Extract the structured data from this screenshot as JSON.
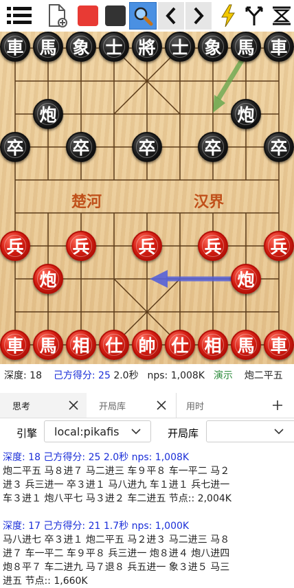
{
  "toolbar": {
    "buttons": [
      {
        "name": "menu-icon"
      },
      {
        "name": "new-game-icon"
      },
      {
        "name": "red-side-icon",
        "color": "#e83a34"
      },
      {
        "name": "black-side-icon",
        "color": "#333333"
      },
      {
        "name": "search-icon"
      },
      {
        "name": "previous-icon"
      },
      {
        "name": "next-icon"
      },
      {
        "name": "lightning-icon",
        "color": "#f2c800"
      },
      {
        "name": "branch-icon"
      },
      {
        "name": "flip-board-icon"
      }
    ]
  },
  "board": {
    "river_left": "楚河",
    "river_right": "汉界",
    "pieces": [
      {
        "c": "車",
        "side": "black"
      },
      {
        "c": "馬",
        "side": "black"
      },
      {
        "c": "象",
        "side": "black"
      },
      {
        "c": "士",
        "side": "black"
      },
      {
        "c": "將",
        "side": "black"
      },
      {
        "c": "士",
        "side": "black"
      },
      {
        "c": "象",
        "side": "black"
      },
      {
        "c": "馬",
        "side": "black"
      },
      {
        "c": "車",
        "side": "black"
      },
      {
        "c": "炮",
        "side": "black"
      },
      {
        "c": "炮",
        "side": "black"
      },
      {
        "c": "卒",
        "side": "black"
      },
      {
        "c": "卒",
        "side": "black"
      },
      {
        "c": "卒",
        "side": "black"
      },
      {
        "c": "卒",
        "side": "black"
      },
      {
        "c": "卒",
        "side": "black"
      },
      {
        "c": "兵",
        "side": "red"
      },
      {
        "c": "兵",
        "side": "red"
      },
      {
        "c": "兵",
        "side": "red"
      },
      {
        "c": "兵",
        "side": "red"
      },
      {
        "c": "兵",
        "side": "red"
      },
      {
        "c": "炮",
        "side": "red"
      },
      {
        "c": "炮",
        "side": "red"
      },
      {
        "c": "車",
        "side": "red"
      },
      {
        "c": "馬",
        "side": "red"
      },
      {
        "c": "相",
        "side": "red"
      },
      {
        "c": "仕",
        "side": "red"
      },
      {
        "c": "帥",
        "side": "red"
      },
      {
        "c": "仕",
        "side": "red"
      },
      {
        "c": "相",
        "side": "red"
      },
      {
        "c": "馬",
        "side": "red"
      },
      {
        "c": "車",
        "side": "red"
      }
    ],
    "arrow_colors": {
      "blue": "#5560d8",
      "green": "#6aa84f"
    }
  },
  "status": {
    "depth": "深度: 18",
    "score": "己方得分: 25",
    "time": "2.0秒",
    "nps": "nps: 1,008K",
    "demo": "演示",
    "move": "炮二平五"
  },
  "tabs": [
    {
      "label": "思考",
      "active": true
    },
    {
      "label": "开局库",
      "active": false
    },
    {
      "label": "用时",
      "active": false
    }
  ],
  "engine": {
    "label": "引擎",
    "value": "local:pikafis",
    "book_label": "开局库",
    "book_value": ""
  },
  "output": [
    {
      "hdr": true,
      "text": "深度: 18  己方得分: 25  2.0秒  nps: 1,008K"
    },
    {
      "hdr": false,
      "text": "炮二平五    马８进７    马二进三    车９平８    车一平二    马２"
    },
    {
      "hdr": false,
      "text": "进３    兵三进一    卒３进１    马八进九    车１进１    兵七进一"
    },
    {
      "hdr": false,
      "text": "车３进１    炮八平七    马３进２    车二进五    节点:: 2,004K"
    },
    {
      "hdr": false,
      "text": ""
    },
    {
      "hdr": true,
      "text": "深度: 17  己方得分: 21  1.7秒  nps: 1,000K"
    },
    {
      "hdr": false,
      "text": "马八进七    卒３进１    炮二平五    马２进３    马二进三    马８"
    },
    {
      "hdr": false,
      "text": "进７    车一平二    车９平８    兵三进一    炮８进４    炮八进四"
    },
    {
      "hdr": false,
      "text": "炮８平７    车二进九    马７退８    兵五进一    象３进５    马三"
    },
    {
      "hdr": false,
      "text": "进五    节点:: 1,660K"
    }
  ]
}
